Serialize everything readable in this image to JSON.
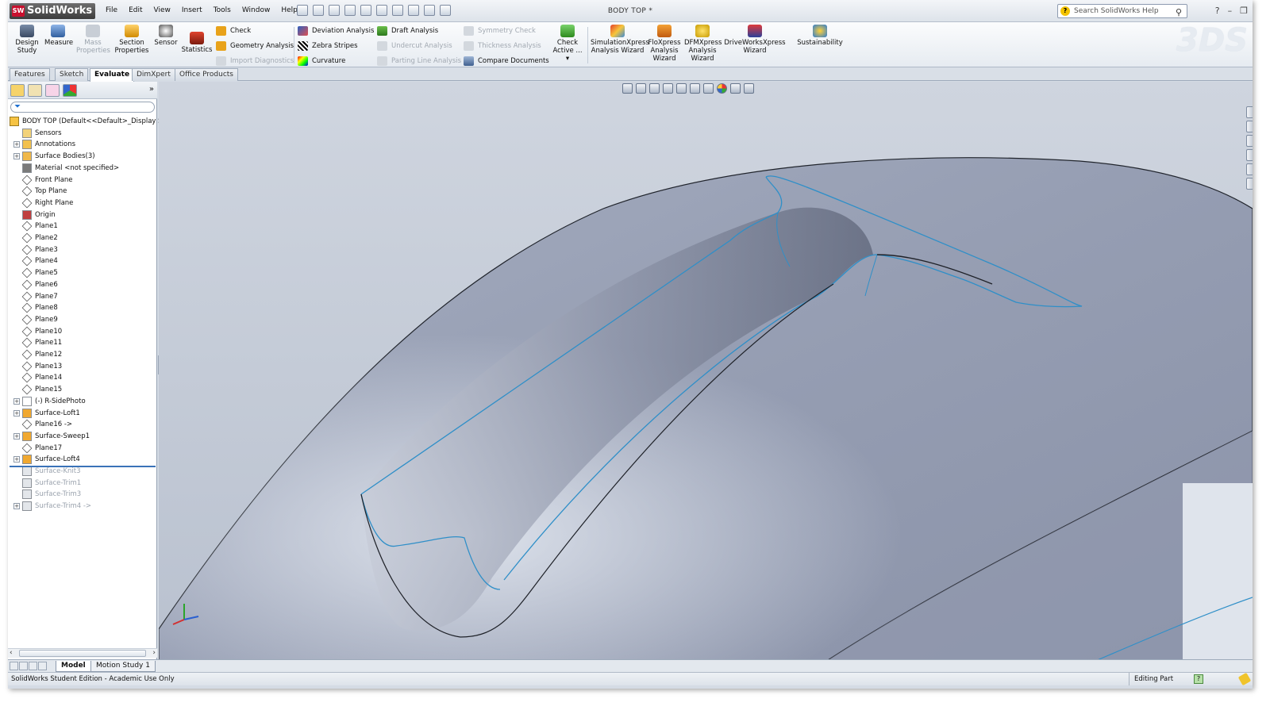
{
  "app": {
    "brand": "SolidWorks",
    "brand_mark": "SW",
    "document_title": "BODY TOP *"
  },
  "menu": [
    "File",
    "Edit",
    "View",
    "Insert",
    "Tools",
    "Window",
    "Help"
  ],
  "search": {
    "placeholder": "Search SolidWorks Help"
  },
  "ribbon": {
    "design_study": "Design Study",
    "measure": "Measure",
    "mass_properties": "Mass Properties",
    "section_properties": "Section Properties",
    "sensor": "Sensor",
    "statistics": "Statistics",
    "col1": [
      "Check",
      "Geometry Analysis",
      "Import Diagnostics"
    ],
    "col2": [
      "Deviation Analysis",
      "Zebra Stripes",
      "Curvature"
    ],
    "col3": [
      "Draft Analysis",
      "Undercut Analysis",
      "Parting Line Analysis"
    ],
    "col4": [
      "Symmetry Check",
      "Thickness Analysis",
      "Compare Documents"
    ],
    "check_active": "Check Active ...",
    "simulationxpress": "SimulationXpress Analysis Wizard",
    "floxpress": "FloXpress Analysis Wizard",
    "dfmxpress": "DFMXpress Analysis Wizard",
    "driveworksxpress": "DriveWorksXpress Wizard",
    "sustainability": "Sustainability"
  },
  "tabs": [
    "Features",
    "Sketch",
    "Evaluate",
    "DimXpert",
    "Office Products"
  ],
  "active_tab": "Evaluate",
  "tree": {
    "root": "BODY TOP  (Default<<Default>_Display S",
    "items": [
      {
        "label": "Sensors",
        "icon": "sensor-folder-icon"
      },
      {
        "label": "Annotations",
        "icon": "annotations-icon"
      },
      {
        "label": "Surface Bodies(3)",
        "icon": "surface-bodies-icon"
      },
      {
        "label": "Material <not specified>",
        "icon": "material-icon"
      },
      {
        "label": "Front Plane",
        "icon": "plane-icon"
      },
      {
        "label": "Top Plane",
        "icon": "plane-icon"
      },
      {
        "label": "Right Plane",
        "icon": "plane-icon"
      },
      {
        "label": "Origin",
        "icon": "origin-icon"
      },
      {
        "label": "Plane1",
        "icon": "plane-icon"
      },
      {
        "label": "Plane2",
        "icon": "plane-icon"
      },
      {
        "label": "Plane3",
        "icon": "plane-icon"
      },
      {
        "label": "Plane4",
        "icon": "plane-icon"
      },
      {
        "label": "Plane5",
        "icon": "plane-icon"
      },
      {
        "label": "Plane6",
        "icon": "plane-icon"
      },
      {
        "label": "Plane7",
        "icon": "plane-icon"
      },
      {
        "label": "Plane8",
        "icon": "plane-icon"
      },
      {
        "label": "Plane9",
        "icon": "plane-icon"
      },
      {
        "label": "Plane10",
        "icon": "plane-icon"
      },
      {
        "label": "Plane11",
        "icon": "plane-icon"
      },
      {
        "label": "Plane12",
        "icon": "plane-icon"
      },
      {
        "label": "Plane13",
        "icon": "plane-icon"
      },
      {
        "label": "Plane14",
        "icon": "plane-icon"
      },
      {
        "label": "Plane15",
        "icon": "plane-icon"
      },
      {
        "label": "(-) R-SidePhoto",
        "icon": "sketch-icon"
      },
      {
        "label": "Surface-Loft1",
        "icon": "loft-icon"
      },
      {
        "label": "Plane16 ->",
        "icon": "plane-icon"
      },
      {
        "label": "Surface-Sweep1",
        "icon": "sweep-icon"
      },
      {
        "label": "Plane17",
        "icon": "plane-icon"
      },
      {
        "label": "Surface-Loft4",
        "icon": "loft-icon"
      },
      {
        "label": "Surface-Knit3",
        "icon": "knit-icon"
      },
      {
        "label": "Surface-Trim1",
        "icon": "trim-icon"
      },
      {
        "label": "Surface-Trim3",
        "icon": "trim-icon"
      },
      {
        "label": "Surface-Trim4 ->",
        "icon": "trim-icon"
      }
    ]
  },
  "bottom_tabs": [
    "Model",
    "Motion Study 1"
  ],
  "status": {
    "left": "SolidWorks Student Edition - Academic Use Only",
    "mode": "Editing Part"
  },
  "colors": {
    "edge_blue": "#2f8fc8",
    "surface": "#9aa3b8",
    "brand_red": "#c8102e"
  }
}
